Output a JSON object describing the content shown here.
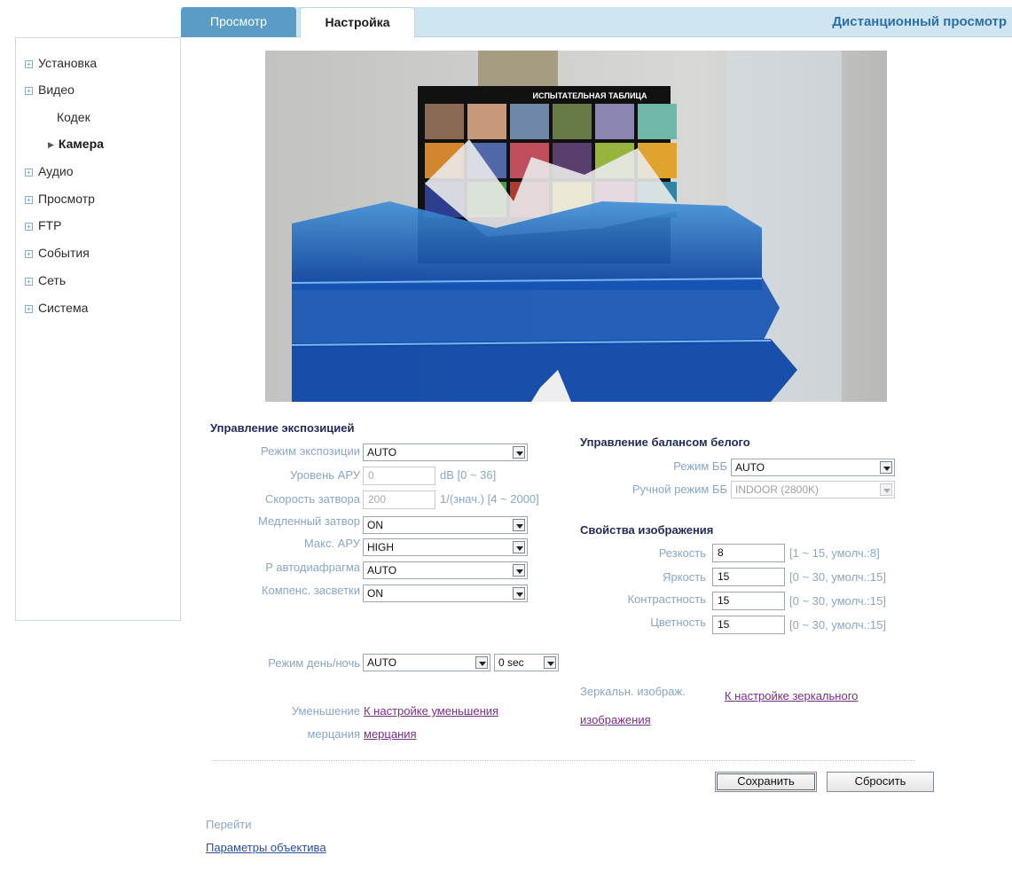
{
  "tabs": {
    "preview": "Просмотр",
    "settings": "Настройка",
    "remote": "Дистанционный просмотр"
  },
  "sidebar": {
    "items": [
      {
        "label": "Установка"
      },
      {
        "label": "Видео"
      },
      {
        "label": "Кодек"
      },
      {
        "label": "Камера"
      },
      {
        "label": "Аудио"
      },
      {
        "label": "Просмотр"
      },
      {
        "label": "FTP"
      },
      {
        "label": "События"
      },
      {
        "label": "Сеть"
      },
      {
        "label": "Система"
      }
    ]
  },
  "camera_chart": {
    "title": "ИСПЫТАТЕЛЬНАЯ ТАБЛИЦА",
    "colors": [
      "#8a6a52",
      "#c8987a",
      "#7088a8",
      "#687a46",
      "#8a86b0",
      "#6fb8a8",
      "#d4862e",
      "#5068a8",
      "#c04e5c",
      "#5a3e6e",
      "#98b43e",
      "#e0a42e",
      "#2e3e8e",
      "#4e9a4e",
      "#b03a32",
      "#e8c82e",
      "#b64e98",
      "#2e86a4"
    ]
  },
  "exposure": {
    "title": "Управление экспозицией",
    "mode_label": "Режим экспозиции",
    "mode_value": "AUTO",
    "agc_label": "Уровень АРУ",
    "agc_value": "0",
    "agc_hint": "dB [0 ~ 36]",
    "shutter_label": "Скорость затвора",
    "shutter_value": "200",
    "shutter_hint": "1/(знач.) [4 ~ 2000]",
    "slow_shutter_label": "Медленный затвор",
    "slow_shutter_value": "ON",
    "max_agc_label": "Макс. АРУ",
    "max_agc_value": "HIGH",
    "iris_label": "P автодиафрагма",
    "iris_value": "AUTO",
    "blc_label": "Компенс. засветки",
    "blc_value": "ON"
  },
  "white_balance": {
    "title": "Управление балансом белого",
    "mode_label": "Режим ББ",
    "mode_value": "AUTO",
    "manual_label": "Ручной режим ББ",
    "manual_value": "INDOOR (2800K)"
  },
  "image_props": {
    "title": "Свойства изображения",
    "sharpness_label": "Резкость",
    "sharpness_value": "8",
    "sharpness_hint": "[1 ~ 15, умолч.:8]",
    "brightness_label": "Яркость",
    "brightness_value": "15",
    "brightness_hint": "[0 ~ 30, умолч.:15]",
    "contrast_label": "Контрастность",
    "contrast_value": "15",
    "contrast_hint": "[0 ~ 30, умолч.:15]",
    "color_label": "Цветность",
    "color_value": "15",
    "color_hint": "[0 ~ 30, умолч.:15]"
  },
  "day_night": {
    "label": "Режим день/ночь",
    "value": "AUTO",
    "delay_value": "0 sec"
  },
  "flicker": {
    "label_line1": "Уменьшение",
    "label_line2": "мерцания",
    "link_line1": "К настройке уменьшения",
    "link_line2": "мерцания"
  },
  "mirror": {
    "label": "Зеркальн. изображ.",
    "link_line1": "К настройке зеркального",
    "link_line2": "изображения"
  },
  "buttons": {
    "save": "Сохранить",
    "reset": "Сбросить"
  },
  "goto": {
    "label": "Перейти",
    "lens_link": "Параметры объектива"
  }
}
